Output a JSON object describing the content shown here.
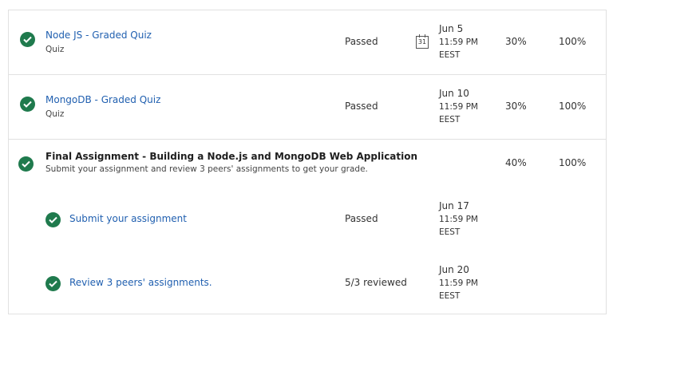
{
  "colors": {
    "check": "#1f7a4d",
    "link": "#2160b0"
  },
  "items": [
    {
      "title": "Node JS - Graded Quiz",
      "type": "Quiz",
      "status": "Passed",
      "due_date": "Jun 5",
      "due_time": "11:59 PM",
      "due_tz": "EEST",
      "weight": "30%",
      "grade": "100%",
      "calendar_icon_text": "31"
    },
    {
      "title": "MongoDB - Graded Quiz",
      "type": "Quiz",
      "status": "Passed",
      "due_date": "Jun 10",
      "due_time": "11:59 PM",
      "due_tz": "EEST",
      "weight": "30%",
      "grade": "100%"
    }
  ],
  "final": {
    "title": "Final Assignment - Building a Node.js and MongoDB Web Application",
    "description": "Submit your assignment and review 3 peers' assignments to get your grade.",
    "weight": "40%",
    "grade": "100%",
    "steps": [
      {
        "title": "Submit your assignment",
        "status": "Passed",
        "due_date": "Jun 17",
        "due_time": "11:59 PM",
        "due_tz": "EEST"
      },
      {
        "title": "Review 3 peers' assignments.",
        "status": "5/3 reviewed",
        "due_date": "Jun 20",
        "due_time": "11:59 PM",
        "due_tz": "EEST"
      }
    ]
  }
}
